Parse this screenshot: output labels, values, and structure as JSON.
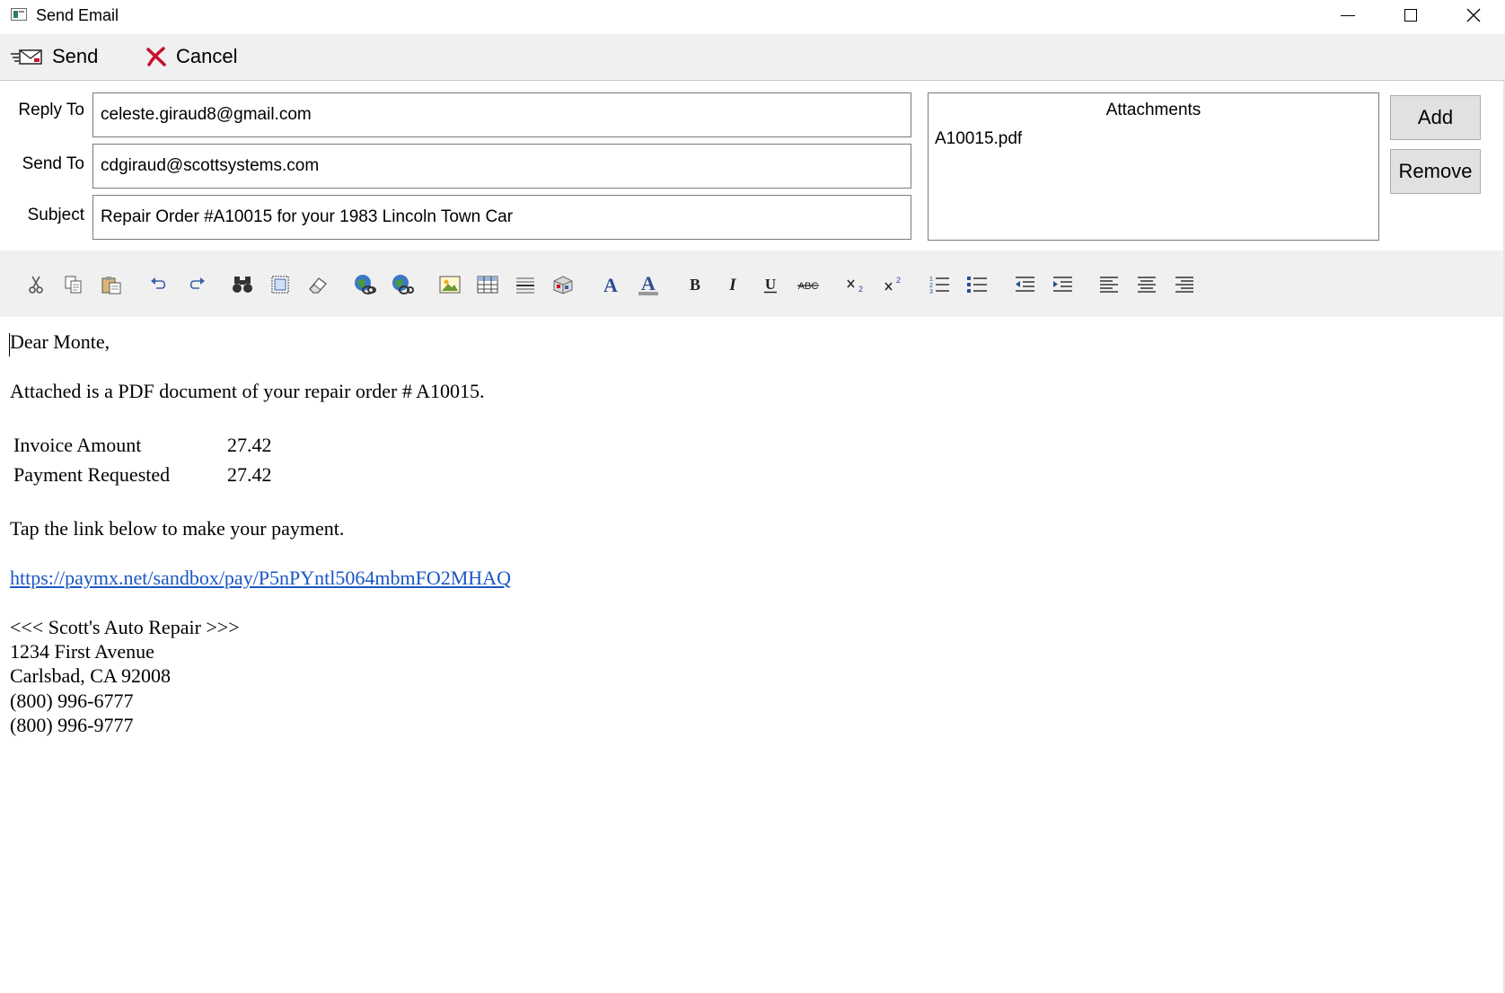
{
  "window": {
    "title": "Send Email",
    "app_icon": "app-window-icon",
    "controls": {
      "minimize_icon": "minimize-icon",
      "maximize_icon": "maximize-icon",
      "close_icon": "close-icon"
    }
  },
  "commands": {
    "send": {
      "label": "Send",
      "icon": "send-mail-icon"
    },
    "cancel": {
      "label": "Cancel",
      "icon": "red-x-icon",
      "icon_color": "#c8102e"
    }
  },
  "form": {
    "reply_to": {
      "label": "Reply To",
      "value": "celeste.giraud8@gmail.com"
    },
    "send_to": {
      "label": "Send To",
      "value": "cdgiraud@scottsystems.com"
    },
    "subject": {
      "label": "Subject",
      "value": "Repair Order #A10015 for your 1983 Lincoln Town Car"
    }
  },
  "attachments": {
    "title": "Attachments",
    "items": [
      "A10015.pdf"
    ],
    "add_label": "Add",
    "remove_label": "Remove"
  },
  "toolbar": {
    "tools": [
      "cut",
      "copy",
      "paste",
      "undo",
      "redo",
      "find",
      "select-all",
      "clear-format",
      "insert-link",
      "remove-link",
      "insert-image",
      "insert-table",
      "horizontal-rule",
      "insert-object",
      "font-color",
      "highlight-color",
      "bold",
      "italic",
      "underline",
      "strikethrough",
      "subscript",
      "superscript",
      "numbered-list",
      "bullet-list",
      "outdent",
      "indent",
      "align-left",
      "align-center",
      "align-right"
    ]
  },
  "body": {
    "greeting": "Dear Monte,",
    "intro": "Attached is a PDF document of your repair order # A10015.",
    "amounts": [
      {
        "label": "Invoice Amount",
        "value": "27.42"
      },
      {
        "label": "Payment Requested",
        "value": "27.42"
      }
    ],
    "instruction": "Tap the link below to make your payment.",
    "payment_link": "https://paymx.net/sandbox/pay/P5nPYntl5064mbmFO2MHAQ",
    "link_color": "#1a56c4",
    "signature": [
      "<<<   Scott's Auto Repair   >>>",
      "1234 First Avenue",
      "Carlsbad, CA 92008",
      "(800) 996-6777",
      "(800) 996-9777"
    ]
  }
}
